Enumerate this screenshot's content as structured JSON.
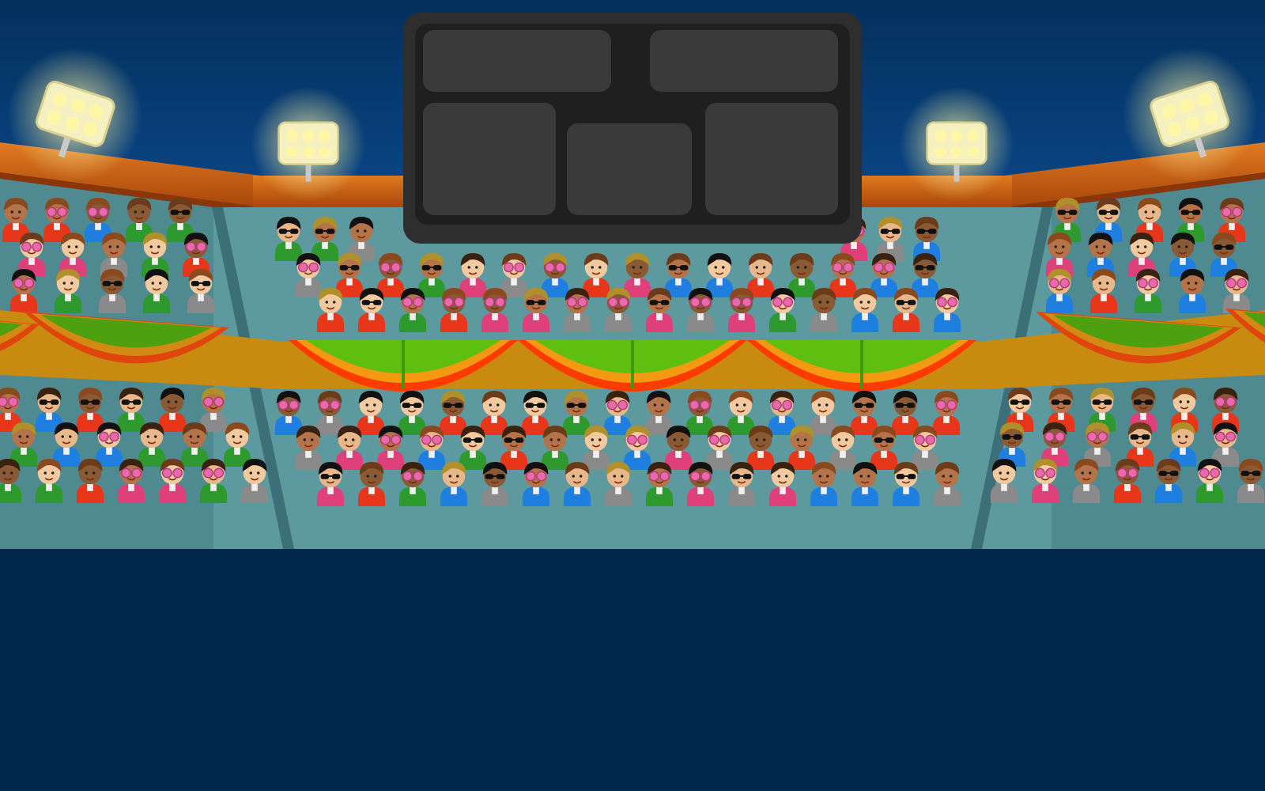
{
  "scene": {
    "colors": {
      "sky_top": "#04305c",
      "sky_bottom": "#0a4a8e",
      "ground": "#01274a",
      "stand_center": "#5d9aa0",
      "stand_side": "#4f8a91",
      "stand_wall": "#3d6f78",
      "roof_orange": "#c85a0e",
      "roof_dark": "#8a3608",
      "light_glow": "#fff6a8",
      "banner_green": "#5fbf10",
      "banner_orange": "#f39a12",
      "banner_red": "#ff3b00",
      "banner_band": "#c98a10",
      "scoreboard_frame": "#2e2e2e",
      "scoreboard_inner": "#1f1f1f",
      "scoreboard_panel": "#3a3a3a"
    },
    "scoreboard": {
      "panels": [
        {
          "id": "top-left",
          "text": ""
        },
        {
          "id": "top-right",
          "text": ""
        },
        {
          "id": "bottom-left",
          "text": ""
        },
        {
          "id": "bottom-center",
          "text": ""
        },
        {
          "id": "bottom-right",
          "text": ""
        }
      ]
    },
    "floodlights": [
      "left-outer",
      "left-inner",
      "right-inner",
      "right-outer"
    ],
    "crowd": {
      "skin_tones": [
        "#f3c9a0",
        "#b5734a",
        "#8a5a34",
        "#e8b88a"
      ],
      "hair_colors": [
        "#6b3b1a",
        "#111111",
        "#8a4a1e",
        "#3a2210",
        "#b0902a"
      ],
      "shirt_colors": [
        "#e8361b",
        "#1e7fe0",
        "#2e9a2e",
        "#8a8a8a",
        "#e0407a"
      ],
      "accessories": [
        "none",
        "sunglasses",
        "heart-glasses"
      ]
    }
  }
}
